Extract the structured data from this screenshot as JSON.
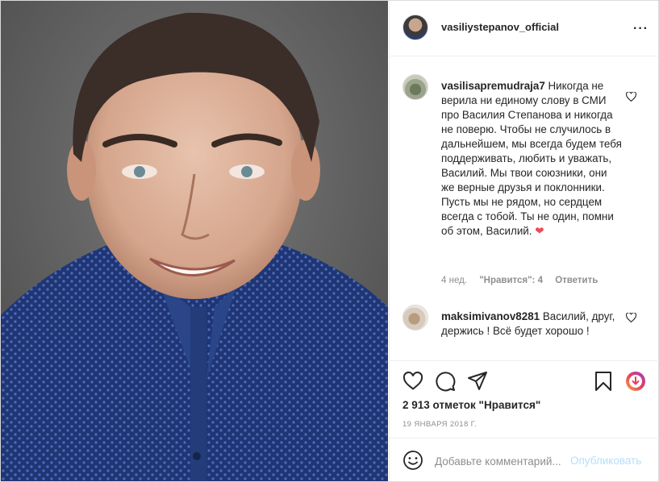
{
  "post": {
    "author": "vasiliystepanov_official",
    "more_icon": "···",
    "likes_text": "2 913 отметок \"Нравится\"",
    "date": "19 ЯНВАРЯ 2018 Г."
  },
  "comments": [
    {
      "username": "vasilisapremudraja7",
      "text": "Никогда не верила ни единому слову в СМИ про Василия Степанова и никогда не поверю. Чтобы не случилось в дальнейшем, мы всегда будем тебя поддерживать, любить и уважать, Василий. Мы твои союзники, они же верные друзья и поклонники. Пусть мы не рядом, но сердцем всегда с тобой. Ты не один, помни об этом, Василий.",
      "emoji": "❤",
      "time": "4 нед.",
      "likes": "\"Нравится\": 4",
      "reply": "Ответить"
    },
    {
      "username": "maksimivanov8281",
      "text": "Василий, друг, держись ! Всё будет хорошо !"
    }
  ],
  "add_comment": {
    "placeholder": "Добавьте комментарий...",
    "publish": "Опубликовать"
  },
  "icons": {
    "heart": "heart-icon",
    "comment": "comment-icon",
    "share": "share-icon",
    "bookmark": "bookmark-icon",
    "emoji": "emoji-icon"
  }
}
